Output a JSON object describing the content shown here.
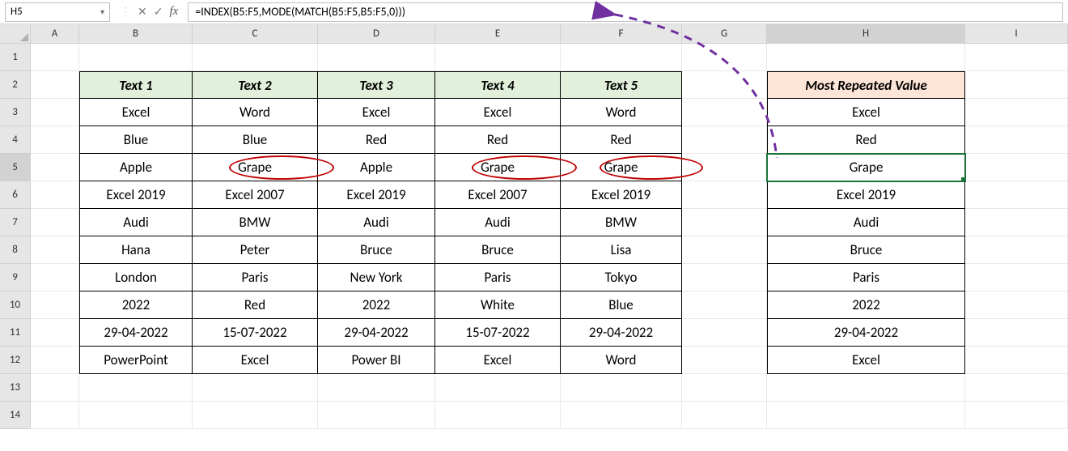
{
  "formula_bar": {
    "name_box": "H5",
    "formula": "=INDEX(B5:F5,MODE(MATCH(B5:F5,B5:F5,0)))"
  },
  "columns": [
    "A",
    "B",
    "C",
    "D",
    "E",
    "F",
    "G",
    "H",
    "I"
  ],
  "active_col": "H",
  "row_count": 14,
  "active_row": 5,
  "headers": {
    "b": "Text 1",
    "c": "Text 2",
    "d": "Text 3",
    "e": "Text 4",
    "f": "Text 5",
    "h": "Most Repeated Value"
  },
  "rows": [
    {
      "b": "Excel",
      "c": "Word",
      "d": "Excel",
      "e": "Excel",
      "f": "Word",
      "h": "Excel"
    },
    {
      "b": "Blue",
      "c": "Blue",
      "d": "Red",
      "e": "Red",
      "f": "Red",
      "h": "Red"
    },
    {
      "b": "Apple",
      "c": "Grape",
      "d": "Apple",
      "e": "Grape",
      "f": "Grape",
      "h": "Grape"
    },
    {
      "b": "Excel 2019",
      "c": "Excel 2007",
      "d": "Excel 2019",
      "e": "Excel 2007",
      "f": "Excel 2019",
      "h": "Excel 2019"
    },
    {
      "b": "Audi",
      "c": "BMW",
      "d": "Audi",
      "e": "Audi",
      "f": "BMW",
      "h": "Audi"
    },
    {
      "b": "Hana",
      "c": "Peter",
      "d": "Bruce",
      "e": "Bruce",
      "f": "Lisa",
      "h": "Bruce"
    },
    {
      "b": "London",
      "c": "Paris",
      "d": "New York",
      "e": "Paris",
      "f": "Tokyo",
      "h": "Paris"
    },
    {
      "b": "2022",
      "c": "Red",
      "d": "2022",
      "e": "White",
      "f": "Blue",
      "h": "2022"
    },
    {
      "b": "29-04-2022",
      "c": "15-07-2022",
      "d": "29-04-2022",
      "e": "15-07-2022",
      "f": "29-04-2022",
      "h": "29-04-2022"
    },
    {
      "b": "PowerPoint",
      "c": "Excel",
      "d": "Power BI",
      "e": "Excel",
      "f": "Word",
      "h": "Excel"
    }
  ],
  "selected_cell": "H5",
  "circled_cells": [
    "C5",
    "E5",
    "F5"
  ],
  "colors": {
    "header_green": "#e2efda",
    "header_pink": "#fce4d6",
    "selection": "#1b7339",
    "circle": "#c00000",
    "arrow": "#7030a0"
  }
}
